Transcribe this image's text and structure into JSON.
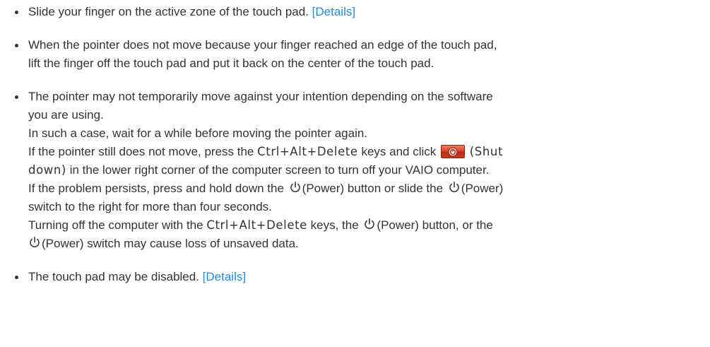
{
  "items": [
    {
      "text": "Slide your finger on the active zone of the touch pad.",
      "link": "[Details]"
    },
    {
      "line1": "When the pointer does not move because your finger reached an edge of the touch pad,",
      "line2": "lift the finger off the touch pad and put it back on the center of the touch pad."
    },
    {
      "line1": "The pointer may not temporarily move against your intention depending on the software",
      "line2": "you are using.",
      "line3": "In such a case, wait for a while before moving the pointer again.",
      "line4_a": "If the pointer still does not move, press the",
      "keys": "Ctrl+Alt+Delete",
      "line4_b": "keys and click",
      "shutdown_label": "(Shut",
      "shutdown_label_2": "down)",
      "line5_b": "in the lower right corner of the computer screen to turn off your VAIO computer.",
      "line6_a": "If the problem persists, press and hold down the",
      "power_button": "(Power) button or slide the",
      "power_label": "(Power)",
      "line7": "switch to the right for more than four seconds.",
      "line8_a": "Turning off the computer with the",
      "line8_b": "keys, the",
      "line8_c": "(Power) button, or the",
      "line9": "(Power) switch may cause loss of unsaved data."
    },
    {
      "text": "The touch pad may be disabled.",
      "link": "[Details]"
    }
  ],
  "icons": {
    "power": "power-icon",
    "shutdown": "shutdown-button-icon"
  },
  "colors": {
    "text": "#333333",
    "link": "#2a88d6",
    "shutdown_red": "#d8412a"
  }
}
